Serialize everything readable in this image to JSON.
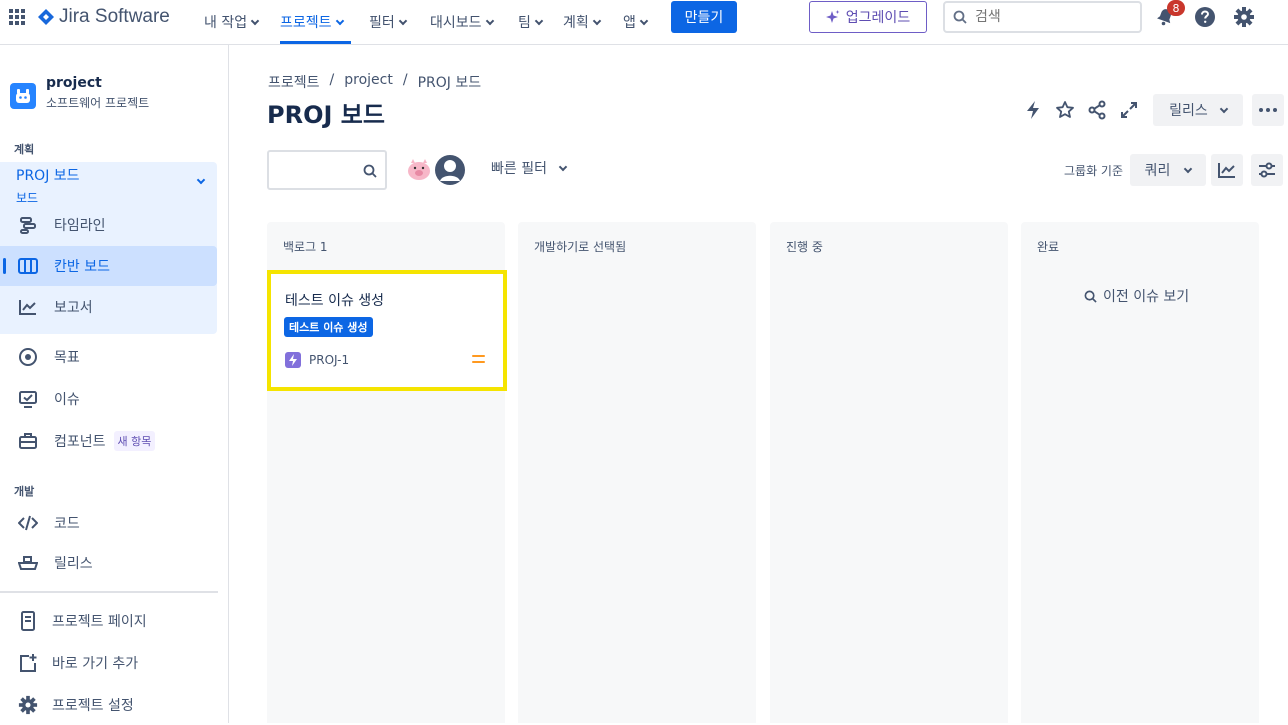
{
  "topnav": {
    "logo_text": "Jira Software",
    "items": [
      {
        "label": "내 작업"
      },
      {
        "label": "프로젝트"
      },
      {
        "label": "필터"
      },
      {
        "label": "대시보드"
      },
      {
        "label": "팀"
      },
      {
        "label": "계획"
      },
      {
        "label": "앱"
      }
    ],
    "create_label": "만들기",
    "upgrade_label": "업그레이드",
    "search_placeholder": "검색",
    "notification_count": "8",
    "colors": {
      "accent": "#0c66e4",
      "upgrade": "#5e4db2",
      "badge": "#c9372c"
    }
  },
  "sidebar": {
    "project_name": "project",
    "project_type": "소프트웨어 프로젝트",
    "section_plan": "계획",
    "board_name": "PROJ 보드",
    "board_sub": "보드",
    "plan_items": [
      {
        "label": "타임라인",
        "icon": "timeline-icon"
      },
      {
        "label": "칸반 보드",
        "icon": "board-icon"
      },
      {
        "label": "보고서",
        "icon": "chart-icon"
      }
    ],
    "other_items": [
      {
        "label": "목표",
        "icon": "goal-icon"
      },
      {
        "label": "이슈",
        "icon": "issues-icon"
      },
      {
        "label": "컴포넌트",
        "icon": "component-icon",
        "tag": "새 항목"
      }
    ],
    "section_dev": "개발",
    "dev_items": [
      {
        "label": "코드",
        "icon": "code-icon"
      },
      {
        "label": "릴리스",
        "icon": "ship-icon"
      }
    ],
    "bottom_items": [
      {
        "label": "프로젝트 페이지",
        "icon": "page-icon"
      },
      {
        "label": "바로 가기 추가",
        "icon": "add-shortcut-icon"
      },
      {
        "label": "프로젝트 설정",
        "icon": "gear-icon"
      }
    ]
  },
  "header": {
    "breadcrumb": [
      "프로젝트",
      "project",
      "PROJ 보드"
    ],
    "title": "PROJ 보드",
    "release_label": "릴리스"
  },
  "toolbar": {
    "quick_filter_label": "빠른 필터",
    "group_label": "그룹화 기준",
    "group_value": "쿼리"
  },
  "board": {
    "columns": [
      {
        "title": "백로그 1"
      },
      {
        "title": "개발하기로 선택됨"
      },
      {
        "title": "진행 중"
      },
      {
        "title": "완료"
      }
    ],
    "card": {
      "title": "테스트 이슈 생성",
      "label": "테스트 이슈 생성",
      "key": "PROJ-1"
    },
    "prev_issues_label": "이전 이슈 보기"
  }
}
